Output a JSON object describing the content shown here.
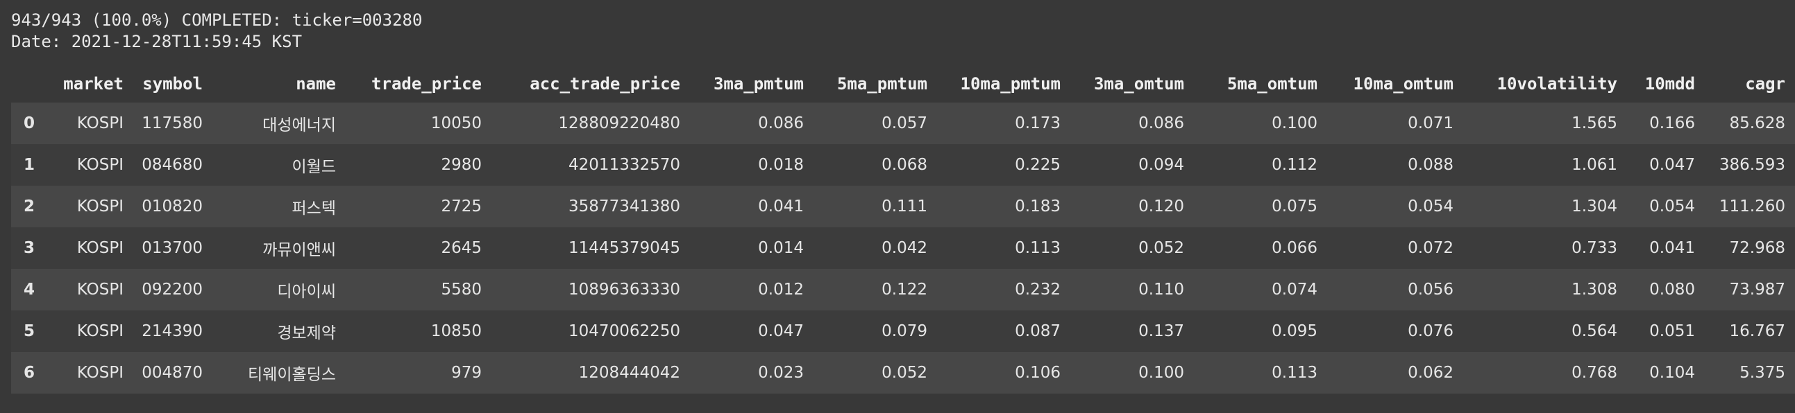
{
  "log": {
    "line1": "943/943 (100.0%) COMPLETED: ticker=003280",
    "line2": "Date: 2021-12-28T11:59:45 KST"
  },
  "table": {
    "columns": [
      "",
      "market",
      "symbol",
      "name",
      "trade_price",
      "acc_trade_price",
      "3ma_pmtum",
      "5ma_pmtum",
      "10ma_pmtum",
      "3ma_omtum",
      "5ma_omtum",
      "10ma_omtum",
      "10volatility",
      "10mdd",
      "cagr"
    ],
    "rows": [
      [
        "0",
        "KOSPI",
        "117580",
        "대성에너지",
        "10050",
        "128809220480",
        "0.086",
        "0.057",
        "0.173",
        "0.086",
        "0.100",
        "0.071",
        "1.565",
        "0.166",
        "85.628"
      ],
      [
        "1",
        "KOSPI",
        "084680",
        "이월드",
        "2980",
        "42011332570",
        "0.018",
        "0.068",
        "0.225",
        "0.094",
        "0.112",
        "0.088",
        "1.061",
        "0.047",
        "386.593"
      ],
      [
        "2",
        "KOSPI",
        "010820",
        "퍼스텍",
        "2725",
        "35877341380",
        "0.041",
        "0.111",
        "0.183",
        "0.120",
        "0.075",
        "0.054",
        "1.304",
        "0.054",
        "111.260"
      ],
      [
        "3",
        "KOSPI",
        "013700",
        "까뮤이앤씨",
        "2645",
        "11445379045",
        "0.014",
        "0.042",
        "0.113",
        "0.052",
        "0.066",
        "0.072",
        "0.733",
        "0.041",
        "72.968"
      ],
      [
        "4",
        "KOSPI",
        "092200",
        "디아이씨",
        "5580",
        "10896363330",
        "0.012",
        "0.122",
        "0.232",
        "0.110",
        "0.074",
        "0.056",
        "1.308",
        "0.080",
        "73.987"
      ],
      [
        "5",
        "KOSPI",
        "214390",
        "경보제약",
        "10850",
        "10470062250",
        "0.047",
        "0.079",
        "0.087",
        "0.137",
        "0.095",
        "0.076",
        "0.564",
        "0.051",
        "16.767"
      ],
      [
        "6",
        "KOSPI",
        "004870",
        "티웨이홀딩스",
        "979",
        "1208444042",
        "0.023",
        "0.052",
        "0.106",
        "0.100",
        "0.113",
        "0.062",
        "0.768",
        "0.104",
        "5.375"
      ]
    ]
  }
}
